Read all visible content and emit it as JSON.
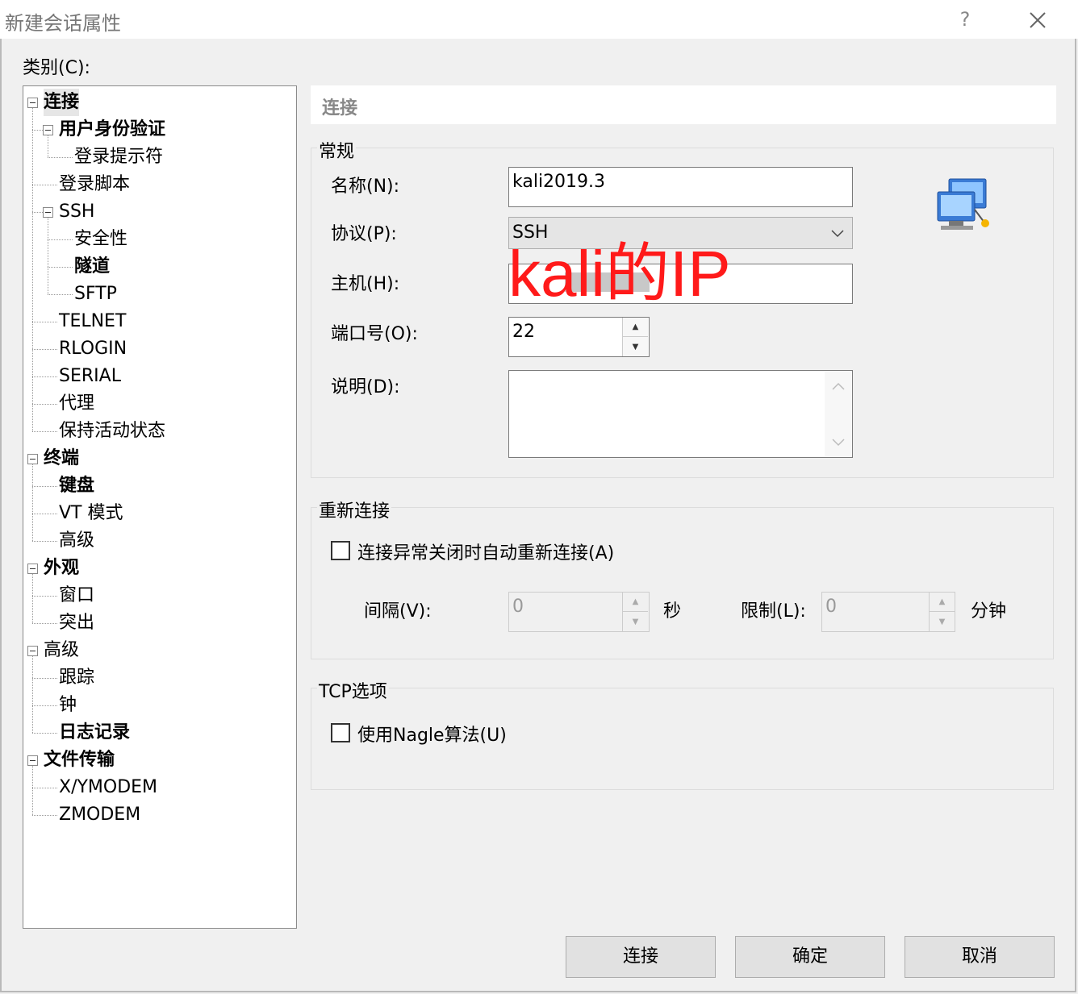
{
  "window": {
    "title": "新建会话属性",
    "help": "?",
    "close": "✕"
  },
  "category_label": "类别(C):",
  "tree": [
    {
      "label": "连接",
      "level": 0,
      "expander": true,
      "bold": true,
      "selected": true
    },
    {
      "label": "用户身份验证",
      "level": 1,
      "expander": true,
      "bold": true
    },
    {
      "label": "登录提示符",
      "level": 2
    },
    {
      "label": "登录脚本",
      "level": 1
    },
    {
      "label": "SSH",
      "level": 1,
      "expander": true
    },
    {
      "label": "安全性",
      "level": 2
    },
    {
      "label": "隧道",
      "level": 2,
      "bold": true
    },
    {
      "label": "SFTP",
      "level": 2
    },
    {
      "label": "TELNET",
      "level": 1
    },
    {
      "label": "RLOGIN",
      "level": 1
    },
    {
      "label": "SERIAL",
      "level": 1
    },
    {
      "label": "代理",
      "level": 1
    },
    {
      "label": "保持活动状态",
      "level": 1
    },
    {
      "label": "终端",
      "level": 0,
      "expander": true,
      "bold": true
    },
    {
      "label": "键盘",
      "level": 1,
      "bold": true
    },
    {
      "label": "VT 模式",
      "level": 1
    },
    {
      "label": "高级",
      "level": 1
    },
    {
      "label": "外观",
      "level": 0,
      "expander": true,
      "bold": true
    },
    {
      "label": "窗口",
      "level": 1
    },
    {
      "label": "突出",
      "level": 1
    },
    {
      "label": "高级",
      "level": 0,
      "expander": true
    },
    {
      "label": "跟踪",
      "level": 1
    },
    {
      "label": "钟",
      "level": 1
    },
    {
      "label": "日志记录",
      "level": 1,
      "bold": true
    },
    {
      "label": "文件传输",
      "level": 0,
      "expander": true,
      "bold": true
    },
    {
      "label": "X/YMODEM",
      "level": 1
    },
    {
      "label": "ZMODEM",
      "level": 1
    }
  ],
  "panel": {
    "header": "连接",
    "general": {
      "title": "常规",
      "name_label": "名称(N):",
      "name_value": "kali2019.3",
      "protocol_label": "协议(P):",
      "protocol_value": "SSH",
      "host_label": "主机(H):",
      "host_value": "",
      "port_label": "端口号(O):",
      "port_value": "22",
      "desc_label": "说明(D):",
      "desc_value": ""
    },
    "annotation": "kali的IP",
    "reconnect": {
      "title": "重新连接",
      "checkbox_label": "连接异常关闭时自动重新连接(A)",
      "interval_label": "间隔(V):",
      "interval_value": "0",
      "interval_unit": "秒",
      "limit_label": "限制(L):",
      "limit_value": "0",
      "limit_unit": "分钟"
    },
    "tcp": {
      "title": "TCP选项",
      "nagle_label": "使用Nagle算法(U)"
    }
  },
  "buttons": {
    "connect": "连接",
    "ok": "确定",
    "cancel": "取消"
  },
  "colors": {
    "annotation": "#ff1a1a",
    "window_bg": "#f0f0f0"
  }
}
